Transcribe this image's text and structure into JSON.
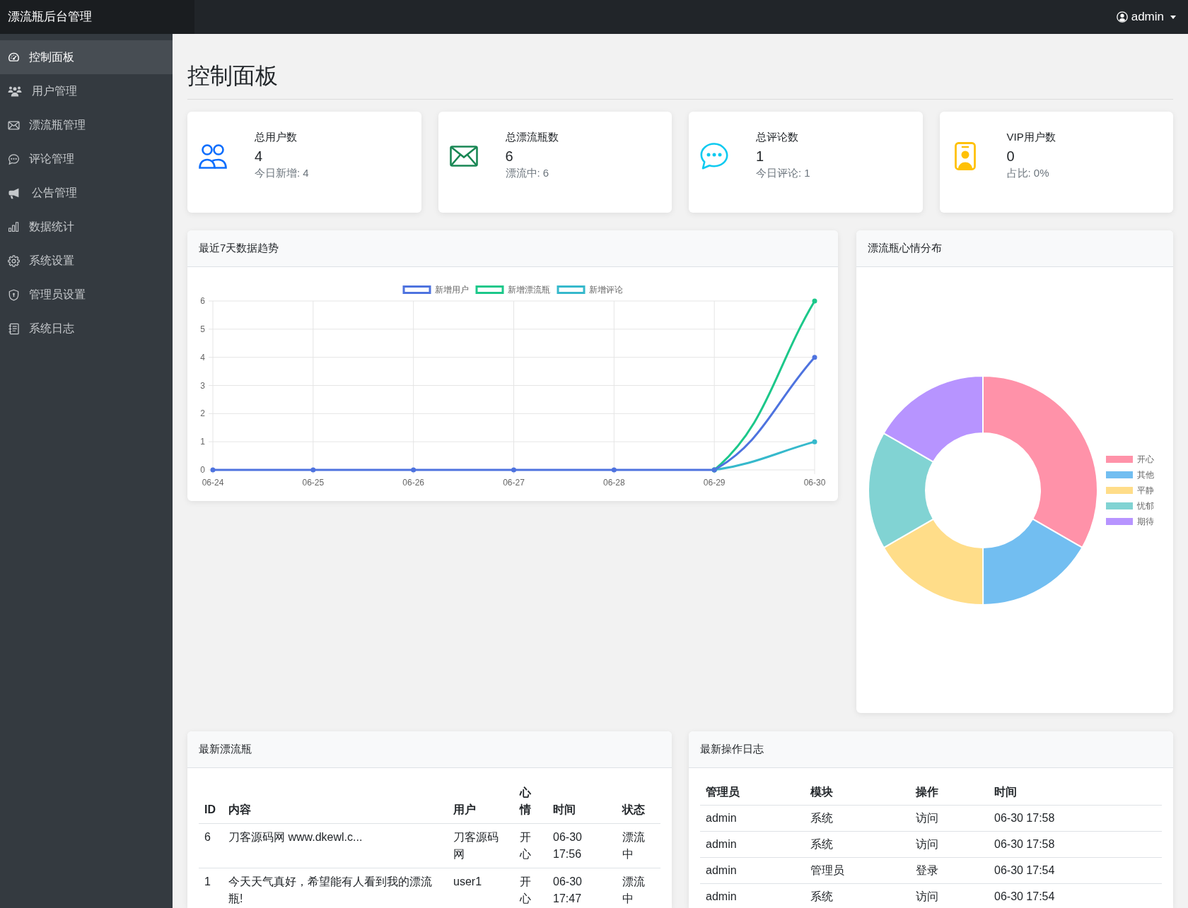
{
  "navbar": {
    "brand": "漂流瓶后台管理",
    "user": "admin"
  },
  "sidebar": {
    "items": [
      {
        "label": "控制面板",
        "selected": true
      },
      {
        "label": "用户管理",
        "selected": false
      },
      {
        "label": "漂流瓶管理",
        "selected": false
      },
      {
        "label": "评论管理",
        "selected": false
      },
      {
        "label": "公告管理",
        "selected": false
      },
      {
        "label": "数据统计",
        "selected": false
      },
      {
        "label": "系统设置",
        "selected": false
      },
      {
        "label": "管理员设置",
        "selected": false
      },
      {
        "label": "系统日志",
        "selected": false
      }
    ]
  },
  "page_title": "控制面板",
  "stats": [
    {
      "title": "总用户数",
      "value": "4",
      "detail": "今日新增: 4"
    },
    {
      "title": "总漂流瓶数",
      "value": "6",
      "detail": "漂流中: 6"
    },
    {
      "title": "总评论数",
      "value": "1",
      "detail": "今日评论: 1"
    },
    {
      "title": "VIP用户数",
      "value": "0",
      "detail": "占比: 0%"
    }
  ],
  "trend_chart": {
    "title": "最近7天数据趋势",
    "chart_data": {
      "type": "line",
      "categories": [
        "06-24",
        "06-25",
        "06-26",
        "06-27",
        "06-28",
        "06-29",
        "06-30"
      ],
      "series": [
        {
          "name": "新增用户",
          "color": "#4e73df",
          "marker": "circle",
          "values": [
            0,
            0,
            0,
            0,
            0,
            0,
            4
          ]
        },
        {
          "name": "新增漂流瓶",
          "color": "#1cc88a",
          "marker": "circle",
          "values": [
            null,
            null,
            null,
            null,
            null,
            0,
            6
          ]
        },
        {
          "name": "新增评论",
          "color": "#36b9cc",
          "marker": "circle",
          "values": [
            null,
            null,
            null,
            null,
            null,
            0,
            1
          ]
        }
      ],
      "ylim": [
        0,
        6
      ],
      "yticks": [
        0,
        1,
        2,
        3,
        4,
        5,
        6
      ],
      "grid": true,
      "legend": "top"
    }
  },
  "mood_chart": {
    "title": "漂流瓶心情分布",
    "chart_data": {
      "type": "donut",
      "categories": [
        "开心",
        "其他",
        "平静",
        "忧郁",
        "期待"
      ],
      "values": [
        33.32,
        16.67,
        16.67,
        16.67,
        16.67
      ],
      "colors": [
        "#ff92a9",
        "#72bef1",
        "#ffdd89",
        "#81d3d3",
        "#b794ff"
      ],
      "legend": "right"
    }
  },
  "latest_bottles": {
    "title": "最新漂流瓶",
    "columns": [
      "ID",
      "内容",
      "用户",
      "心情",
      "时间",
      "状态"
    ],
    "rows": [
      [
        "6",
        "刀客源码网 www.dkewl.c...",
        "刀客源码网",
        "开心",
        "06-30 17:56",
        "漂流中"
      ],
      [
        "1",
        "今天天气真好，希望能有人看到我的漂流瓶!",
        "user1",
        "开心",
        "06-30 17:47",
        "漂流中"
      ]
    ]
  },
  "latest_logs": {
    "title": "最新操作日志",
    "columns": [
      "管理员",
      "模块",
      "操作",
      "时间"
    ],
    "rows": [
      [
        "admin",
        "系统",
        "访问",
        "06-30 17:58"
      ],
      [
        "admin",
        "系统",
        "访问",
        "06-30 17:58"
      ],
      [
        "admin",
        "管理员",
        "登录",
        "06-30 17:54"
      ],
      [
        "admin",
        "系统",
        "访问",
        "06-30 17:54"
      ]
    ]
  }
}
